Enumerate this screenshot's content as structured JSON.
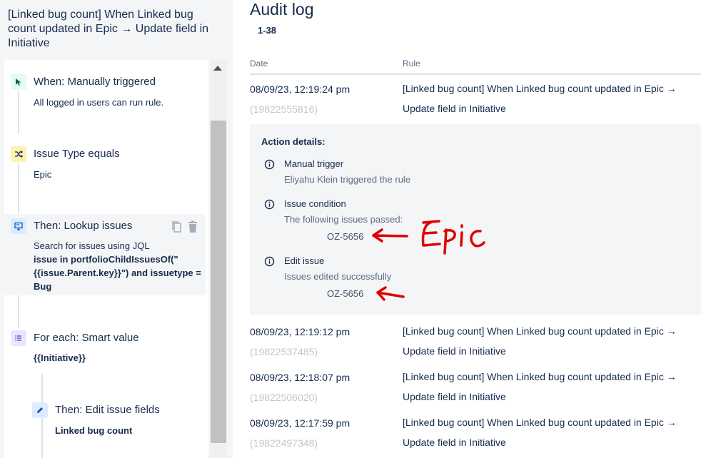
{
  "left": {
    "rule_title": "[Linked bug count] When Linked bug count updated in Epic → Update field in Initiative",
    "steps": [
      {
        "title": "When: Manually triggered",
        "sub": "All logged in users can run rule."
      },
      {
        "title": "Issue Type equals",
        "sub": "Epic"
      },
      {
        "title": "Then: Lookup issues",
        "sub": "Search for issues using JQL",
        "sub_bold": "issue in portfolioChildIssuesOf(\"{{issue.Parent.key}}\") and issuetype = Bug"
      },
      {
        "title": "For each: Smart value",
        "sub_bold": "{{Initiative}}"
      },
      {
        "title": "Then: Edit issue fields",
        "sub_bold": "Linked bug count"
      }
    ]
  },
  "audit": {
    "title": "Audit log",
    "range": "1-38",
    "columns": {
      "date": "Date",
      "rule": "Rule"
    },
    "rows": [
      {
        "date": "08/09/23, 12:19:24 pm",
        "id": "(19822555816)",
        "rule_line1": "[Linked bug count] When Linked bug count updated in Epic →",
        "rule_line2": "Update field in Initiative"
      },
      {
        "date": "08/09/23, 12:19:12 pm",
        "id": "(19822537485)",
        "rule_line1": "[Linked bug count] When Linked bug count updated in Epic →",
        "rule_line2": "Update field in Initiative"
      },
      {
        "date": "08/09/23, 12:18:07 pm",
        "id": "(19822506020)",
        "rule_line1": "[Linked bug count] When Linked bug count updated in Epic →",
        "rule_line2": "Update field in Initiative"
      },
      {
        "date": "08/09/23, 12:17:59 pm",
        "id": "(19822497348)",
        "rule_line1": "[Linked bug count] When Linked bug count updated in Epic →",
        "rule_line2": "Update field in Initiative"
      }
    ],
    "details": {
      "title": "Action details:",
      "items": [
        {
          "head": "Manual trigger",
          "sub": "Eliyahu Klein triggered the rule"
        },
        {
          "head": "Issue condition",
          "sub": "The following issues passed:",
          "key": "OZ-5656"
        },
        {
          "head": "Edit issue",
          "sub": "Issues edited successfully",
          "key": "OZ-5656"
        }
      ]
    },
    "annotation_text": "Epic"
  },
  "colors": {
    "trigger_icon_bg": "#e3fcef",
    "condition_icon_bg": "#fff0b3",
    "action_icon_bg": "#deebff",
    "branch_icon_bg": "#eae6ff",
    "annotation_red": "#e00000"
  }
}
